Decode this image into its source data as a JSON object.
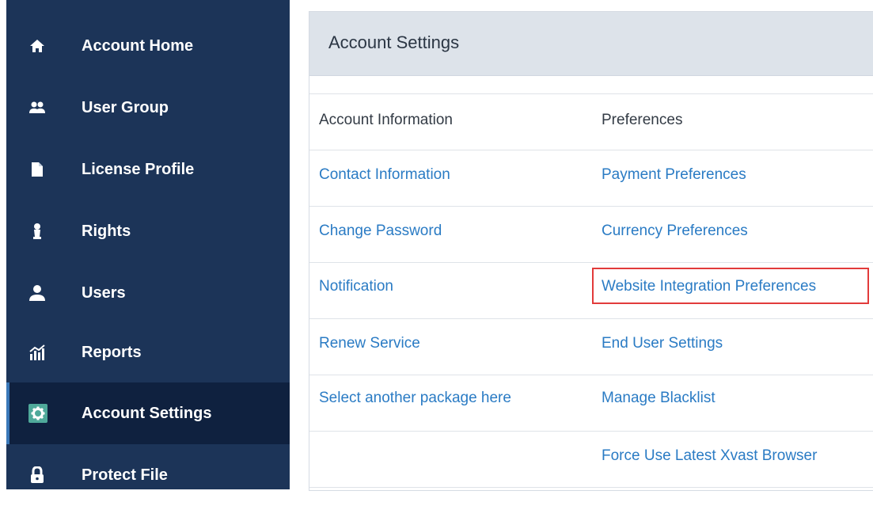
{
  "sidebar": {
    "items": [
      {
        "label": "Account Home",
        "icon": "home-icon"
      },
      {
        "label": "User Group",
        "icon": "user-group-icon"
      },
      {
        "label": "License Profile",
        "icon": "document-icon"
      },
      {
        "label": "Rights",
        "icon": "rights-icon"
      },
      {
        "label": "Users",
        "icon": "user-icon"
      },
      {
        "label": "Reports",
        "icon": "chart-icon"
      },
      {
        "label": "Account Settings",
        "icon": "gear-icon",
        "active": true
      },
      {
        "label": "Protect File",
        "icon": "lock-icon"
      }
    ]
  },
  "panel": {
    "title": "Account Settings",
    "headers": {
      "col1": "Account Information",
      "col2": "Preferences"
    },
    "rows": [
      {
        "col1": "Contact Information",
        "col2": "Payment Preferences"
      },
      {
        "col1": "Change Password",
        "col2": "Currency Preferences"
      },
      {
        "col1": "Notification",
        "col2": "Website Integration Preferences"
      },
      {
        "col1": "Renew Service",
        "col2": "End User Settings"
      },
      {
        "col1": "Select another package here",
        "col2": "Manage Blacklist"
      },
      {
        "col1": "",
        "col2": "Force Use Latest Xvast Browser"
      }
    ]
  },
  "colors": {
    "sidebar_bg": "#1c3458",
    "sidebar_active": "#0f213f",
    "link": "#2a7bc4",
    "highlight": "#e23b3b"
  }
}
